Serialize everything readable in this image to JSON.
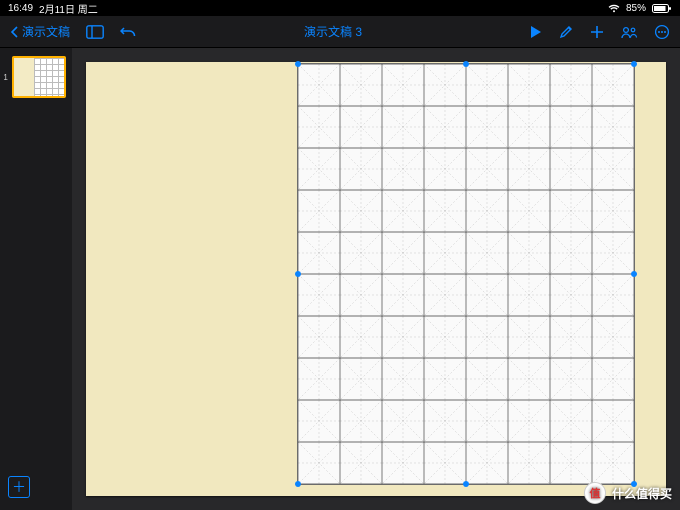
{
  "status": {
    "time": "16:49",
    "date": "2月11日 周二",
    "battery_pct": "85%"
  },
  "toolbar": {
    "back_label": "演示文稿",
    "title": "演示文稿 3"
  },
  "sidebar": {
    "slides": [
      {
        "index": "1"
      }
    ]
  },
  "selected_object": {
    "grid": {
      "cols": 8,
      "rows": 10
    }
  },
  "watermark": {
    "badge": "值",
    "text": "什么值得买"
  }
}
